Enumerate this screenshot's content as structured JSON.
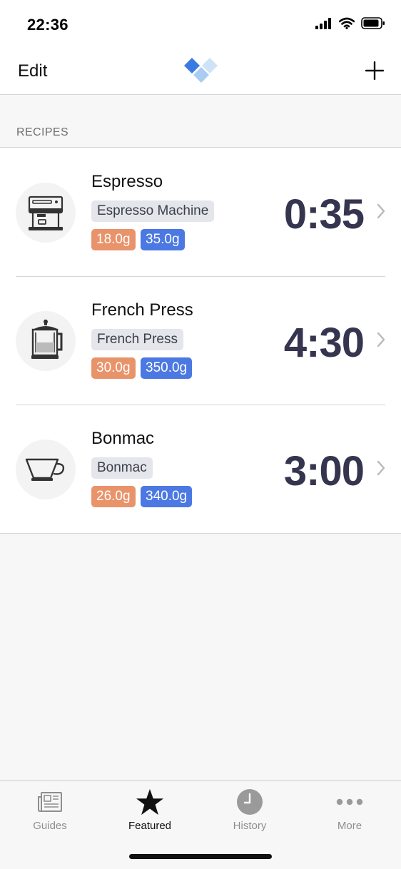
{
  "status_bar": {
    "time": "22:36"
  },
  "nav": {
    "edit_label": "Edit",
    "logo_icon": "diamond-logo-icon",
    "add_icon": "plus-icon"
  },
  "section": {
    "title": "RECIPES"
  },
  "recipes": [
    {
      "name": "Espresso",
      "device": "Espresso Machine",
      "dose": "18.0g",
      "yield": "35.0g",
      "time": "0:35",
      "icon": "espresso-machine-icon"
    },
    {
      "name": "French Press",
      "device": "French Press",
      "dose": "30.0g",
      "yield": "350.0g",
      "time": "4:30",
      "icon": "french-press-icon"
    },
    {
      "name": "Bonmac",
      "device": "Bonmac",
      "dose": "26.0g",
      "yield": "340.0g",
      "time": "3:00",
      "icon": "pour-over-dripper-icon"
    }
  ],
  "tabs": [
    {
      "label": "Guides",
      "icon": "newspaper-icon",
      "active": false
    },
    {
      "label": "Featured",
      "icon": "star-icon",
      "active": true
    },
    {
      "label": "History",
      "icon": "clock-icon",
      "active": false
    },
    {
      "label": "More",
      "icon": "ellipsis-icon",
      "active": false
    }
  ],
  "colors": {
    "dose_tag": "#e9936b",
    "yield_tag": "#4b78e2",
    "device_tag": "#e4e6eb",
    "time_text": "#353550"
  }
}
